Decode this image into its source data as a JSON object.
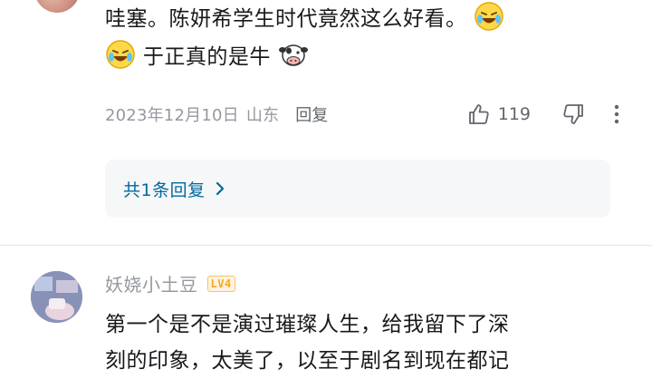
{
  "comment1": {
    "text_line1": "哇塞。陈妍希学生时代竟然这么好看。",
    "text_line2": "于正真的是牛",
    "emojis": [
      "laughing-crying-emoji",
      "laughing-crying-emoji",
      "cow-emoji"
    ],
    "date": "2023年12月10日",
    "location": "山东",
    "reply_label": "回复",
    "like_count": "119",
    "replies_label": "共1条回复"
  },
  "comment2": {
    "username": "妖娆小土豆",
    "level": "LV4",
    "text_line1": "第一个是不是演过璀璨人生，给我留下了深",
    "text_line2": "刻的印象，太美了，以至于剧名到现在都记"
  },
  "colors": {
    "link": "#00699d",
    "meta": "#9499a0",
    "text": "#18191c",
    "level_badge": "#f5a623"
  }
}
